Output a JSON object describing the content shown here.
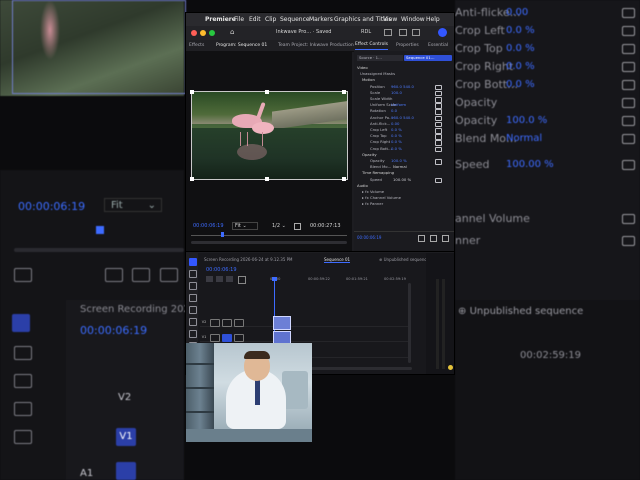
{
  "menu": {
    "apple": "",
    "items": [
      "Premiere",
      "File",
      "Edit",
      "Clip",
      "Sequence",
      "Markers",
      "Graphics and Titles",
      "View",
      "Window",
      "Help"
    ]
  },
  "titlebar": {
    "home": "⌂",
    "project": "Inkwave Pro… · Saved",
    "workspace": "RDL"
  },
  "panel_tabs": {
    "effects": "Effects",
    "program": "Program: Sequence 01",
    "team": "Team Project: Inkwave Production",
    "effect_controls": "Effect Controls",
    "properties": "Properties",
    "essential": "Essential"
  },
  "effect_controls": {
    "source": "Source · 1…",
    "sequence": "Sequence 01…",
    "section_video": "Video",
    "sub_unassigned": "Unassigned Masks",
    "motion": "Motion",
    "rows": [
      {
        "label": "Position",
        "value": "960.0    540.0"
      },
      {
        "label": "Scale",
        "value": "100.0"
      },
      {
        "label": "Scale Width",
        "value": ""
      },
      {
        "label": "Uniform Scale",
        "value": "Uniform"
      },
      {
        "label": "Rotation",
        "value": "0.0"
      },
      {
        "label": "Anchor Po…",
        "value": "960.0    540.0"
      },
      {
        "label": "Anti-flick…",
        "value": "0.00"
      },
      {
        "label": "Crop Left",
        "value": "0.0 %"
      },
      {
        "label": "Crop Top",
        "value": "0.0 %"
      },
      {
        "label": "Crop Right",
        "value": "0.0 %"
      },
      {
        "label": "Crop Bott…",
        "value": "0.0 %"
      }
    ],
    "opacity_group": "Opacity",
    "opacity": {
      "label": "Opacity",
      "value": "100.0 %"
    },
    "blend": {
      "label": "Blend Mo…",
      "value": "Normal"
    },
    "time_remap": "Time Remapping",
    "speed": {
      "label": "Speed",
      "value": "100.00 %"
    },
    "section_audio": "Audio",
    "audio_rows": [
      "Volume",
      "Channel Volume",
      "Panner"
    ],
    "footer_tc": "00:00:06:19"
  },
  "monitor": {
    "timecode": "00:00:06:19",
    "fit": "Fit",
    "ratio": "1/2",
    "duration": "00:00:27:13"
  },
  "timeline": {
    "tab_recording": "Screen Recording 2026-06-24 at 9.12.35 PM",
    "tab_sequence": "Sequence 01",
    "tab_unpublished": "Unpublished sequence",
    "timecode": "00:00:06:19",
    "ruler": [
      "00:00",
      "00:00:59:22",
      "00:01:59:21",
      "00:02:59:19"
    ],
    "tracks": [
      {
        "name": "V2",
        "kind": "video"
      },
      {
        "name": "V1",
        "kind": "video"
      },
      {
        "name": "A1",
        "kind": "audio"
      }
    ]
  },
  "background": {
    "right_labels": [
      "Anti-flicke…",
      "Crop Left",
      "Crop Top",
      "Crop Right",
      "Crop Bott…",
      "Opacity",
      "Opacity",
      "Blend Mo…",
      "Speed",
      "annel Volume",
      "nner"
    ],
    "right_values": [
      "0.00",
      "0.0 %",
      "0.0 %",
      "0.0 %",
      "0.0 %",
      "",
      "100.0 %",
      "Normal",
      "100.00 %",
      "",
      ""
    ],
    "timecode_big": "00:00:06:19",
    "fit_big": "Fit",
    "screen_recording": "Screen Recording 2026-0",
    "timecode_lower": "00:00:06:19",
    "duration_lower": "00:02:59:19",
    "unpublished": "Unpublished sequence",
    "track_v2": "V2",
    "track_v1": "V1",
    "track_a1": "A1"
  }
}
